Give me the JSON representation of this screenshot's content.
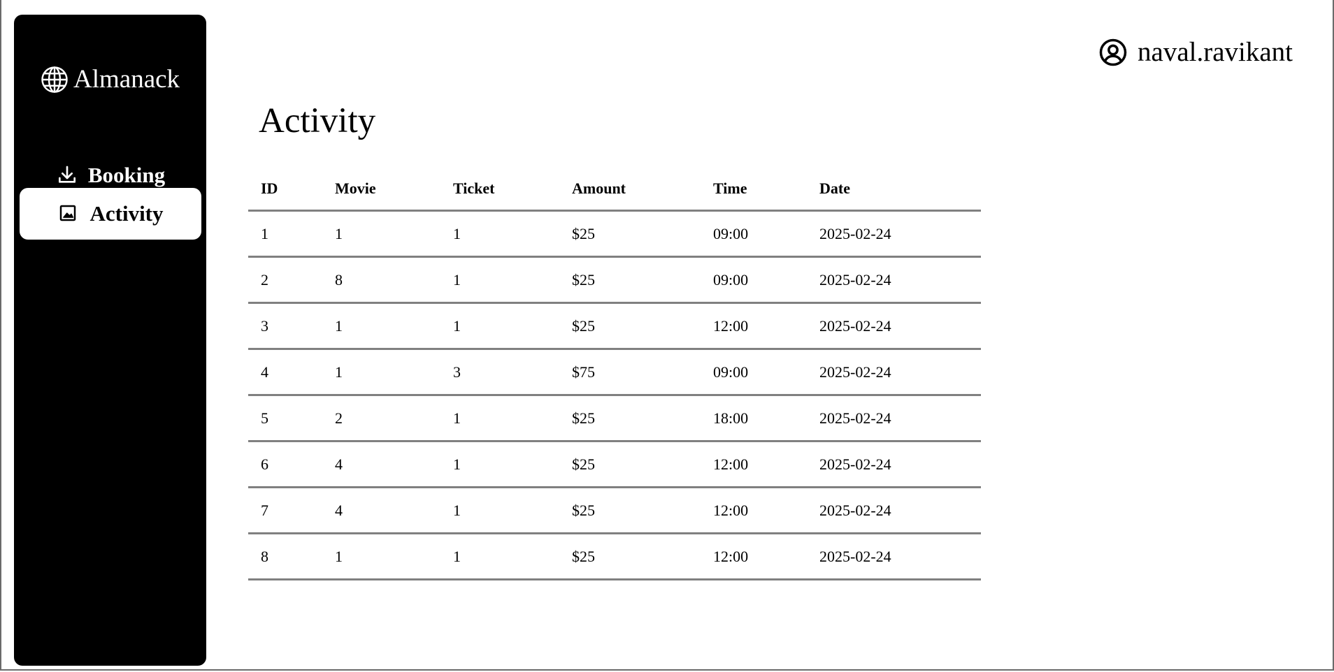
{
  "brand": {
    "name": "Almanack",
    "icon": "globe-icon"
  },
  "sidebar": {
    "items": [
      {
        "label": "Booking",
        "icon": "download-icon",
        "active": false
      },
      {
        "label": "Activity",
        "icon": "image-icon",
        "active": true
      }
    ]
  },
  "user": {
    "username": "naval.ravikant",
    "icon": "user-circle-icon"
  },
  "page": {
    "title": "Activity"
  },
  "table": {
    "columns": [
      "ID",
      "Movie",
      "Ticket",
      "Amount",
      "Time",
      "Date"
    ],
    "rows": [
      [
        "1",
        "1",
        "1",
        "$25",
        "09:00",
        "2025-02-24"
      ],
      [
        "2",
        "8",
        "1",
        "$25",
        "09:00",
        "2025-02-24"
      ],
      [
        "3",
        "1",
        "1",
        "$25",
        "12:00",
        "2025-02-24"
      ],
      [
        "4",
        "1",
        "3",
        "$75",
        "09:00",
        "2025-02-24"
      ],
      [
        "5",
        "2",
        "1",
        "$25",
        "18:00",
        "2025-02-24"
      ],
      [
        "6",
        "4",
        "1",
        "$25",
        "12:00",
        "2025-02-24"
      ],
      [
        "7",
        "4",
        "1",
        "$25",
        "12:00",
        "2025-02-24"
      ],
      [
        "8",
        "1",
        "1",
        "$25",
        "12:00",
        "2025-02-24"
      ]
    ]
  },
  "colors": {
    "sidebar_bg": "#000000",
    "divider": "#808080",
    "active_item_bg": "#ffffff"
  }
}
